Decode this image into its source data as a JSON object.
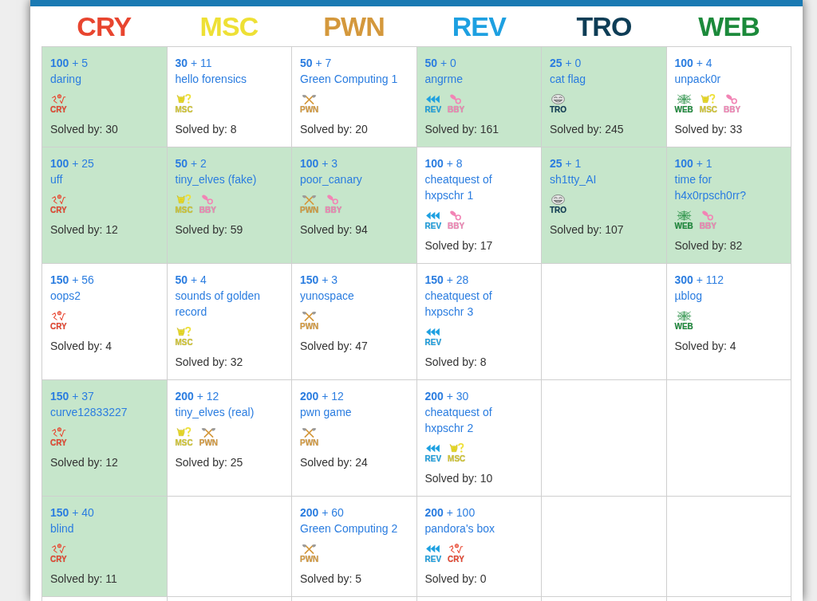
{
  "categories": [
    {
      "title": "CRY",
      "color": "#e8452f",
      "challenges": [
        {
          "points": "**100** + 5",
          "name": "daring",
          "tags": [
            {
              "kind": "cry",
              "label": "CRY",
              "color": "#e8452f"
            }
          ],
          "solved_by": "Solved by: 30",
          "solved": true
        },
        {
          "points": "**100** + 25",
          "name": "uff",
          "tags": [
            {
              "kind": "cry",
              "label": "CRY",
              "color": "#e8452f"
            }
          ],
          "solved_by": "Solved by: 12",
          "solved": true
        },
        {
          "points": "**150** + 56",
          "name": "oops2",
          "tags": [
            {
              "kind": "cry",
              "label": "CRY",
              "color": "#e8452f"
            }
          ],
          "solved_by": "Solved by: 4",
          "solved": false
        },
        {
          "points": "**150** + 37",
          "name": "curve12833227",
          "tags": [
            {
              "kind": "cry",
              "label": "CRY",
              "color": "#e8452f"
            }
          ],
          "solved_by": "Solved by: 12",
          "solved": true
        },
        {
          "points": "**150** + 40",
          "name": "blind",
          "tags": [
            {
              "kind": "cry",
              "label": "CRY",
              "color": "#e8452f"
            }
          ],
          "solved_by": "Solved by: 11",
          "solved": true
        }
      ]
    },
    {
      "title": "MSC",
      "color": "#eee035",
      "challenges": [
        {
          "points": "**30** + 11",
          "name": "hello forensics",
          "tags": [
            {
              "kind": "msc",
              "label": "MSC",
              "color": "#eee035"
            }
          ],
          "solved_by": "Solved by: 8",
          "solved": false
        },
        {
          "points": "**50** + 2",
          "name": "tiny_elves (fake)",
          "tags": [
            {
              "kind": "msc",
              "label": "MSC",
              "color": "#eee035"
            },
            {
              "kind": "bby",
              "label": "BBY",
              "color": "#f284b5"
            }
          ],
          "solved_by": "Solved by: 59",
          "solved": true
        },
        {
          "points": "**50** + 4",
          "name": "sounds of golden record",
          "tags": [
            {
              "kind": "msc",
              "label": "MSC",
              "color": "#eee035"
            }
          ],
          "solved_by": "Solved by: 32",
          "solved": false
        },
        {
          "points": "**200** + 12",
          "name": "tiny_elves (real)",
          "tags": [
            {
              "kind": "msc",
              "label": "MSC",
              "color": "#eee035"
            },
            {
              "kind": "pwn",
              "label": "PWN",
              "color": "#d4983c"
            }
          ],
          "solved_by": "Solved by: 25",
          "solved": false
        }
      ]
    },
    {
      "title": "PWN",
      "color": "#d4983c",
      "challenges": [
        {
          "points": "**50** + 7",
          "name": "Green Computing 1",
          "tags": [
            {
              "kind": "pwn",
              "label": "PWN",
              "color": "#d4983c"
            }
          ],
          "solved_by": "Solved by: 20",
          "solved": false
        },
        {
          "points": "**100** + 3",
          "name": "poor_canary",
          "tags": [
            {
              "kind": "pwn",
              "label": "PWN",
              "color": "#d4983c"
            },
            {
              "kind": "bby",
              "label": "BBY",
              "color": "#f284b5"
            }
          ],
          "solved_by": "Solved by: 94",
          "solved": true
        },
        {
          "points": "**150** + 3",
          "name": "yunospace",
          "tags": [
            {
              "kind": "pwn",
              "label": "PWN",
              "color": "#d4983c"
            }
          ],
          "solved_by": "Solved by: 47",
          "solved": false
        },
        {
          "points": "**200** + 12",
          "name": "pwn game",
          "tags": [
            {
              "kind": "pwn",
              "label": "PWN",
              "color": "#d4983c"
            }
          ],
          "solved_by": "Solved by: 24",
          "solved": false
        },
        {
          "points": "**200** + 60",
          "name": "Green Computing 2",
          "tags": [
            {
              "kind": "pwn",
              "label": "PWN",
              "color": "#d4983c"
            }
          ],
          "solved_by": "Solved by: 5",
          "solved": false
        }
      ]
    },
    {
      "title": "REV",
      "color": "#1da0e1",
      "challenges": [
        {
          "points": "**50** + 0",
          "name": "angrme",
          "tags": [
            {
              "kind": "rev",
              "label": "REV",
              "color": "#1da0e1"
            },
            {
              "kind": "bby",
              "label": "BBY",
              "color": "#f284b5"
            }
          ],
          "solved_by": "Solved by: 161",
          "solved": true
        },
        {
          "points": "**100** + 8",
          "name": "cheatquest of hxpschr 1",
          "tags": [
            {
              "kind": "rev",
              "label": "REV",
              "color": "#1da0e1"
            },
            {
              "kind": "bby",
              "label": "BBY",
              "color": "#f284b5"
            }
          ],
          "solved_by": "Solved by: 17",
          "solved": false
        },
        {
          "points": "**150** + 28",
          "name": "cheatquest of hxpschr 3",
          "tags": [
            {
              "kind": "rev",
              "label": "REV",
              "color": "#1da0e1"
            }
          ],
          "solved_by": "Solved by: 8",
          "solved": false
        },
        {
          "points": "**200** + 30",
          "name": "cheatquest of hxpschr 2",
          "tags": [
            {
              "kind": "rev",
              "label": "REV",
              "color": "#1da0e1"
            },
            {
              "kind": "msc",
              "label": "MSC",
              "color": "#eee035"
            }
          ],
          "solved_by": "Solved by: 10",
          "solved": false
        },
        {
          "points": "**200** + 100",
          "name": "pandora's box",
          "tags": [
            {
              "kind": "rev",
              "label": "REV",
              "color": "#1da0e1"
            },
            {
              "kind": "cry",
              "label": "CRY",
              "color": "#e8452f"
            }
          ],
          "solved_by": "Solved by: 0",
          "solved": false
        }
      ]
    },
    {
      "title": "TRO",
      "color": "#0e3d56",
      "challenges": [
        {
          "points": "**25** + 0",
          "name": "cat flag",
          "tags": [
            {
              "kind": "tro",
              "label": "TRO",
              "color": "#0e3d56"
            }
          ],
          "solved_by": "Solved by: 245",
          "solved": true
        },
        {
          "points": "**25** + 1",
          "name": "sh1tty_AI",
          "tags": [
            {
              "kind": "tro",
              "label": "TRO",
              "color": "#0e3d56"
            }
          ],
          "solved_by": "Solved by: 107",
          "solved": true
        }
      ]
    },
    {
      "title": "WEB",
      "color": "#1c8a3b",
      "challenges": [
        {
          "points": "**100** + 4",
          "name": "unpack0r",
          "tags": [
            {
              "kind": "web",
              "label": "WEB",
              "color": "#1c8a3b"
            },
            {
              "kind": "msc",
              "label": "MSC",
              "color": "#eee035"
            },
            {
              "kind": "bby",
              "label": "BBY",
              "color": "#f284b5"
            }
          ],
          "solved_by": "Solved by: 33",
          "solved": false
        },
        {
          "points": "**100** + 1",
          "name": "time for h4x0rpsch0rr?",
          "tags": [
            {
              "kind": "web",
              "label": "WEB",
              "color": "#1c8a3b"
            },
            {
              "kind": "bby",
              "label": "BBY",
              "color": "#f284b5"
            }
          ],
          "solved_by": "Solved by: 82",
          "solved": true
        },
        {
          "points": "**300** + 112",
          "name": "µblog",
          "tags": [
            {
              "kind": "web",
              "label": "WEB",
              "color": "#1c8a3b"
            }
          ],
          "solved_by": "Solved by: 4",
          "solved": false
        }
      ]
    }
  ]
}
